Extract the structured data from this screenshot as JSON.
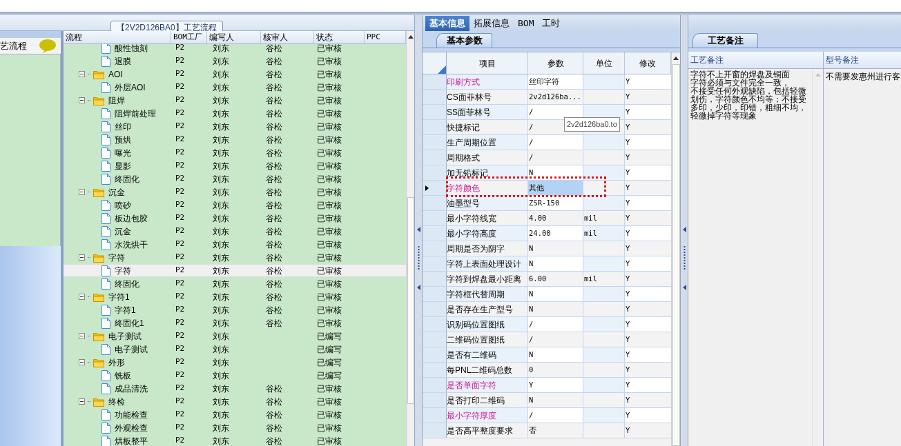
{
  "title_bar": {
    "title": "【2V2D126BA0】工艺流程"
  },
  "sidebar": {
    "title": "艺流程"
  },
  "process_tree": {
    "columns": [
      "流程",
      "BOM工厂",
      "编写人",
      "核审人",
      "状态",
      "PPC"
    ],
    "rows": [
      {
        "children": [
          {
            "label": "酸性蚀刻",
            "bom": "P2",
            "writer": "刘东",
            "reviewer": "谷松",
            "status": "已审核",
            "selected": false
          },
          {
            "label": "退膜",
            "bom": "P2",
            "writer": "刘东",
            "reviewer": "谷松",
            "status": "已审核",
            "selected": false
          }
        ]
      },
      {
        "label": "AOI",
        "bom": "P2",
        "writer": "刘东",
        "reviewer": "谷松",
        "status": "已审核",
        "expanded": true,
        "selected": false,
        "children": [
          {
            "label": "外层AOI",
            "bom": "P2",
            "writer": "刘东",
            "reviewer": "谷松",
            "status": "已审核",
            "selected": false
          }
        ]
      },
      {
        "label": "阻焊",
        "bom": "P2",
        "writer": "刘东",
        "reviewer": "谷松",
        "status": "已审核",
        "expanded": true,
        "selected": false,
        "children": [
          {
            "label": "阻焊前处理",
            "bom": "P2",
            "writer": "刘东",
            "reviewer": "谷松",
            "status": "已审核",
            "selected": false
          },
          {
            "label": "丝印",
            "bom": "P2",
            "writer": "刘东",
            "reviewer": "谷松",
            "status": "已审核",
            "selected": false
          },
          {
            "label": "预烘",
            "bom": "P2",
            "writer": "刘东",
            "reviewer": "谷松",
            "status": "已审核",
            "selected": false
          },
          {
            "label": "曝光",
            "bom": "P2",
            "writer": "刘东",
            "reviewer": "谷松",
            "status": "已审核",
            "selected": false
          },
          {
            "label": "显影",
            "bom": "P2",
            "writer": "刘东",
            "reviewer": "谷松",
            "status": "已审核",
            "selected": false
          },
          {
            "label": "终固化",
            "bom": "P2",
            "writer": "刘东",
            "reviewer": "谷松",
            "status": "已审核",
            "selected": false
          }
        ]
      },
      {
        "label": "沉金",
        "bom": "P2",
        "writer": "刘东",
        "reviewer": "谷松",
        "status": "已审核",
        "expanded": true,
        "selected": false,
        "children": [
          {
            "label": "喷砂",
            "bom": "P2",
            "writer": "刘东",
            "reviewer": "谷松",
            "status": "已审核",
            "selected": false
          },
          {
            "label": "板边包胶",
            "bom": "P2",
            "writer": "刘东",
            "reviewer": "谷松",
            "status": "已审核",
            "selected": false
          },
          {
            "label": "沉金",
            "bom": "P2",
            "writer": "刘东",
            "reviewer": "谷松",
            "status": "已审核",
            "selected": false
          },
          {
            "label": "水洗烘干",
            "bom": "P2",
            "writer": "刘东",
            "reviewer": "谷松",
            "status": "已审核",
            "selected": false
          }
        ]
      },
      {
        "label": "字符",
        "bom": "P2",
        "writer": "刘东",
        "reviewer": "谷松",
        "status": "已审核",
        "expanded": true,
        "selected": false,
        "children": [
          {
            "label": "字符",
            "bom": "P2",
            "writer": "刘东",
            "reviewer": "谷松",
            "status": "已审核",
            "selected": true
          },
          {
            "label": "终固化",
            "bom": "P2",
            "writer": "刘东",
            "reviewer": "谷松",
            "status": "已审核",
            "selected": false
          }
        ]
      },
      {
        "label": "字符1",
        "bom": "P2",
        "writer": "刘东",
        "reviewer": "谷松",
        "status": "已审核",
        "expanded": true,
        "selected": false,
        "children": [
          {
            "label": "字符1",
            "bom": "P2",
            "writer": "刘东",
            "reviewer": "谷松",
            "status": "已审核",
            "selected": false
          },
          {
            "label": "终固化1",
            "bom": "P2",
            "writer": "刘东",
            "reviewer": "谷松",
            "status": "已审核",
            "selected": false
          }
        ]
      },
      {
        "label": "电子测试",
        "bom": "P2",
        "writer": "刘东",
        "status": "已编写",
        "expanded": true,
        "selected": false,
        "children": [
          {
            "label": "电子测试",
            "bom": "P2",
            "writer": "刘东",
            "status": "已编写",
            "selected": false
          }
        ]
      },
      {
        "label": "外形",
        "bom": "P2",
        "writer": "刘东",
        "status": "已编写",
        "expanded": true,
        "selected": false,
        "children": [
          {
            "label": "铣板",
            "bom": "P2",
            "writer": "刘东",
            "status": "已编写",
            "selected": false
          },
          {
            "label": "成品清洗",
            "bom": "P2",
            "writer": "刘东",
            "reviewer": "谷松",
            "status": "已审核",
            "selected": false
          }
        ]
      },
      {
        "label": "终检",
        "bom": "P2",
        "writer": "刘东",
        "reviewer": "谷松",
        "status": "已审核",
        "expanded": true,
        "selected": false,
        "children": [
          {
            "label": "功能检查",
            "bom": "P2",
            "writer": "刘东",
            "reviewer": "谷松",
            "status": "已审核",
            "selected": false
          },
          {
            "label": "外观检查",
            "bom": "P2",
            "writer": "刘东",
            "reviewer": "谷松",
            "status": "已审核",
            "selected": false
          },
          {
            "label": "烘板整平",
            "bom": "P2",
            "writer": "刘东",
            "reviewer": "谷松",
            "status": "已审核",
            "selected": false
          }
        ]
      }
    ]
  },
  "detail_tabs": [
    {
      "label": "基本信息",
      "selected": true
    },
    {
      "label": "拓展信息",
      "selected": false
    },
    {
      "label": "BOM",
      "selected": false
    },
    {
      "label": "工时",
      "selected": false
    }
  ],
  "sub_tab": "基本参数",
  "param_grid": {
    "columns": [
      "项目",
      "参数",
      "单位",
      "修改"
    ],
    "rows": [
      {
        "item": "印刷方式",
        "param": "丝印字符",
        "modify": "Y",
        "highlighted": true,
        "selected": false
      },
      {
        "item": "CS面菲林号",
        "param": "2v2d126ba...",
        "modify": "Y",
        "highlighted": false,
        "selected": false
      },
      {
        "item": "SS面菲林号",
        "param": "/",
        "modify": "Y",
        "highlighted": false,
        "selected": false
      },
      {
        "item": "快捷标记",
        "param": "/",
        "modify": "Y",
        "highlighted": false,
        "selected": false
      },
      {
        "item": "生产周期位置",
        "param": "/",
        "modify": "Y",
        "highlighted": false,
        "selected": false
      },
      {
        "item": "周期格式",
        "param": "/",
        "modify": "Y",
        "highlighted": false,
        "selected": false
      },
      {
        "item": "加无铅标记",
        "param": "N",
        "modify": "Y",
        "highlighted": false,
        "selected": false
      },
      {
        "item": "字符颜色",
        "param": "其他",
        "modify": "Y",
        "highlighted": true,
        "selected": true
      },
      {
        "item": "油墨型号",
        "param": "ZSR-150",
        "modify": "Y",
        "highlighted": false,
        "selected": false
      },
      {
        "item": "最小字符线宽",
        "param": "4.00",
        "unit": "mil",
        "modify": "Y",
        "highlighted": false,
        "selected": false
      },
      {
        "item": "最小字符高度",
        "param": "24.00",
        "unit": "mil",
        "modify": "Y",
        "highlighted": false,
        "selected": false
      },
      {
        "item": "周期是否为阴字",
        "param": "N",
        "modify": "Y",
        "highlighted": false,
        "selected": false
      },
      {
        "item": "字符上表面处理设计",
        "param": "N",
        "modify": "Y",
        "highlighted": false,
        "selected": false
      },
      {
        "item": "字符到焊盘最小距离",
        "param": "6.00",
        "unit": "mil",
        "modify": "Y",
        "highlighted": false,
        "selected": false
      },
      {
        "item": "字符框代替周期",
        "param": "N",
        "modify": "Y",
        "highlighted": false,
        "selected": false
      },
      {
        "item": "是否存在生产型号",
        "param": "N",
        "modify": "Y",
        "highlighted": false,
        "selected": false
      },
      {
        "item": "识别码位置图纸",
        "param": "/",
        "modify": "Y",
        "highlighted": false,
        "selected": false
      },
      {
        "item": "二维码位置图纸",
        "param": "/",
        "modify": "Y",
        "highlighted": false,
        "selected": false
      },
      {
        "item": "是否有二维码",
        "param": "N",
        "modify": "Y",
        "highlighted": false,
        "selected": false
      },
      {
        "item": "每PNL二维码总数",
        "param": "0",
        "modify": "Y",
        "highlighted": false,
        "selected": false
      },
      {
        "item": "是否单面字符",
        "param": "Y",
        "modify": "Y",
        "highlighted": true,
        "selected": false
      },
      {
        "item": "是否打印二维码",
        "param": "N",
        "modify": "Y",
        "highlighted": false,
        "selected": false
      },
      {
        "item": "最小字符厚度",
        "param": "/",
        "modify": "Y",
        "highlighted": true,
        "selected": false
      },
      {
        "item": "是否高平整度要求",
        "param": "否",
        "modify": "Y",
        "highlighted": false,
        "selected": false
      }
    ]
  },
  "tooltip": "2v2d126ba0.to",
  "notes_panel": {
    "tab": "工艺备注",
    "columns": [
      "工艺备注",
      "型号备注"
    ],
    "process_note": [
      "字符不上开窗的焊盘及铜面",
      "字符必须与文件完全一致，",
      "不接受任何外观缺陷，包括轻微",
      "划伤，字符颜色不均等；不接受",
      "多印，少印，印错，粗细不均，",
      "轻微掉字符等现象"
    ],
    "model_note": "不需要发惠州进行客"
  }
}
